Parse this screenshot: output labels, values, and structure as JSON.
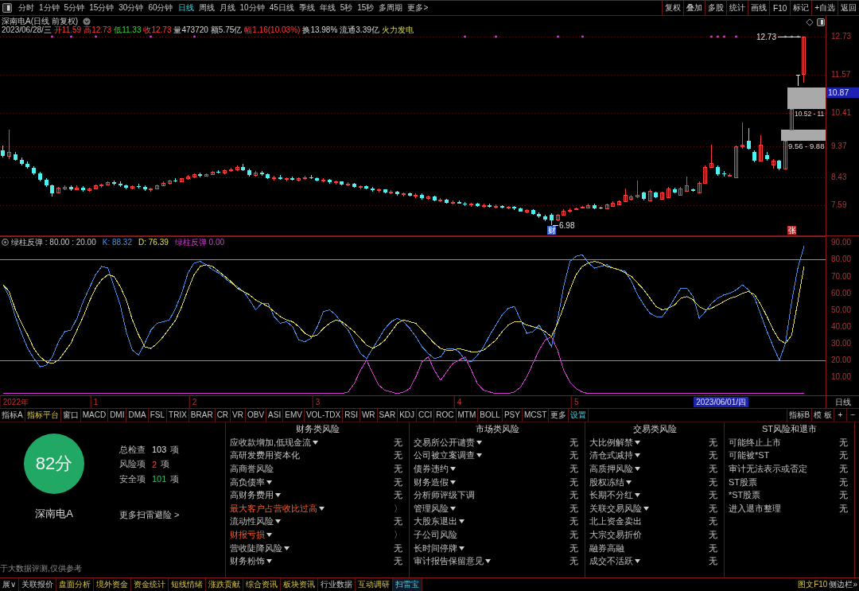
{
  "toolbar": {
    "periods": [
      {
        "label": "分时",
        "selected": false
      },
      {
        "label": "1分钟",
        "selected": false
      },
      {
        "label": "5分钟",
        "selected": false
      },
      {
        "label": "15分钟",
        "selected": false
      },
      {
        "label": "30分钟",
        "selected": false
      },
      {
        "label": "60分钟",
        "selected": false
      },
      {
        "label": "日线",
        "selected": true
      },
      {
        "label": "周线",
        "selected": false
      },
      {
        "label": "月线",
        "selected": false
      },
      {
        "label": "10分钟",
        "selected": false
      },
      {
        "label": "45日线",
        "selected": false
      },
      {
        "label": "季线",
        "selected": false
      },
      {
        "label": "年线",
        "selected": false
      },
      {
        "label": "5秒",
        "selected": false
      },
      {
        "label": "15秒",
        "selected": false
      },
      {
        "label": "多周期",
        "selected": false
      },
      {
        "label": "更多>",
        "selected": false
      }
    ],
    "actions": [
      "复权",
      "叠加",
      "多股",
      "统计",
      "画线",
      "F10",
      "标记",
      "+自选",
      "返回"
    ]
  },
  "quote": {
    "title": "深南电A(日线 前复权)",
    "date": "2023/06/28/三",
    "fields": [
      {
        "text": "开11.59",
        "kind": "up"
      },
      {
        "text": "高12.73",
        "kind": "up"
      },
      {
        "text": "低11.33",
        "kind": "down"
      },
      {
        "text": "收12.73",
        "kind": "up"
      },
      {
        "text": "量473720",
        "kind": "plain"
      },
      {
        "text": "额5.75亿",
        "kind": "plain"
      },
      {
        "text": "幅1.16(10.03%)",
        "kind": "up"
      },
      {
        "text": "换13.98%",
        "kind": "plain"
      },
      {
        "text": "流通3.39亿",
        "kind": "plain"
      },
      {
        "text": "火力发电",
        "kind": "sector"
      }
    ]
  },
  "main_chart": {
    "chart_data": [
      {
        "type": "candlestick",
        "ylim": [
          6.66,
          13.39
        ],
        "yticks": [
          12.73,
          11.57,
          10.41,
          9.37,
          8.43,
          7.59
        ],
        "tick_labels": "y",
        "grid": true,
        "ohlc": [
          [
            9.25,
            9.4,
            9.05,
            9.1
          ],
          [
            9.1,
            9.9,
            9.0,
            9.2
          ],
          [
            9.15,
            9.22,
            8.95,
            8.98
          ],
          [
            8.98,
            9.05,
            8.8,
            8.85
          ],
          [
            8.85,
            8.92,
            8.7,
            8.74
          ],
          [
            8.72,
            8.78,
            8.5,
            8.55
          ],
          [
            8.55,
            8.6,
            8.3,
            8.35
          ],
          [
            8.35,
            8.42,
            8.15,
            8.2
          ],
          [
            8.18,
            8.22,
            7.85,
            7.95
          ],
          [
            7.98,
            8.15,
            7.95,
            8.12
          ],
          [
            8.1,
            8.2,
            8.05,
            8.15
          ],
          [
            8.15,
            8.2,
            8.02,
            8.08
          ],
          [
            8.08,
            8.18,
            8.05,
            8.12
          ],
          [
            8.12,
            8.16,
            8.0,
            8.04
          ],
          [
            8.04,
            8.12,
            8.0,
            8.1
          ],
          [
            8.1,
            8.22,
            8.08,
            8.18
          ],
          [
            8.18,
            8.25,
            8.12,
            8.22
          ],
          [
            8.22,
            8.32,
            8.18,
            8.28
          ],
          [
            8.28,
            8.34,
            8.2,
            8.24
          ],
          [
            8.24,
            8.3,
            8.15,
            8.18
          ],
          [
            8.18,
            8.22,
            8.08,
            8.12
          ],
          [
            8.12,
            8.2,
            8.06,
            8.16
          ],
          [
            8.16,
            8.24,
            8.1,
            8.14
          ],
          [
            8.14,
            8.18,
            8.02,
            8.06
          ],
          [
            8.06,
            8.12,
            8.0,
            8.1
          ],
          [
            8.1,
            8.22,
            8.08,
            8.2
          ],
          [
            8.2,
            8.3,
            8.16,
            8.26
          ],
          [
            8.26,
            8.36,
            8.22,
            8.33
          ],
          [
            8.33,
            8.4,
            8.28,
            8.3
          ],
          [
            8.3,
            8.42,
            8.28,
            8.4
          ],
          [
            8.4,
            8.5,
            8.36,
            8.46
          ],
          [
            8.46,
            8.56,
            8.42,
            8.52
          ],
          [
            8.52,
            8.58,
            8.44,
            8.48
          ],
          [
            8.48,
            8.56,
            8.45,
            8.54
          ],
          [
            8.54,
            8.62,
            8.5,
            8.6
          ],
          [
            8.6,
            8.66,
            8.55,
            8.58
          ],
          [
            8.58,
            8.68,
            8.54,
            8.65
          ],
          [
            8.65,
            8.72,
            8.6,
            8.68
          ],
          [
            8.68,
            8.8,
            8.64,
            8.76
          ],
          [
            8.76,
            8.85,
            8.62,
            8.66
          ],
          [
            8.66,
            8.7,
            8.45,
            8.5
          ],
          [
            8.5,
            8.62,
            8.46,
            8.58
          ],
          [
            8.58,
            8.64,
            8.48,
            8.52
          ],
          [
            8.52,
            8.56,
            8.38,
            8.42
          ],
          [
            8.42,
            8.48,
            8.34,
            8.44
          ],
          [
            8.44,
            8.5,
            8.36,
            8.38
          ],
          [
            8.38,
            8.44,
            8.3,
            8.4
          ],
          [
            8.4,
            8.46,
            8.34,
            8.36
          ],
          [
            8.36,
            8.44,
            8.32,
            8.42
          ],
          [
            8.42,
            8.48,
            8.36,
            8.44
          ],
          [
            8.44,
            8.5,
            8.38,
            8.4
          ],
          [
            8.4,
            8.44,
            8.3,
            8.34
          ],
          [
            8.34,
            8.4,
            8.28,
            8.36
          ],
          [
            8.36,
            8.38,
            8.24,
            8.28
          ],
          [
            8.28,
            8.34,
            8.22,
            8.3
          ],
          [
            8.3,
            8.32,
            8.18,
            8.22
          ],
          [
            8.22,
            8.28,
            8.16,
            8.24
          ],
          [
            8.24,
            8.26,
            8.12,
            8.15
          ],
          [
            8.15,
            8.2,
            8.08,
            8.17
          ],
          [
            8.17,
            8.2,
            8.06,
            8.1
          ],
          [
            8.1,
            8.14,
            8.0,
            8.04
          ],
          [
            8.04,
            8.1,
            7.96,
            8.06
          ],
          [
            8.06,
            8.08,
            7.94,
            7.98
          ],
          [
            7.98,
            8.04,
            7.92,
            8.0
          ],
          [
            8.0,
            8.02,
            7.88,
            7.92
          ],
          [
            7.92,
            7.98,
            7.86,
            7.95
          ],
          [
            7.95,
            7.98,
            7.84,
            7.88
          ],
          [
            7.88,
            7.94,
            7.8,
            7.9
          ],
          [
            7.9,
            7.94,
            7.76,
            7.8
          ],
          [
            7.8,
            7.88,
            7.76,
            7.84
          ],
          [
            7.84,
            7.88,
            7.7,
            7.74
          ],
          [
            7.74,
            7.8,
            7.68,
            7.76
          ],
          [
            7.76,
            7.78,
            7.62,
            7.66
          ],
          [
            7.66,
            7.72,
            7.6,
            7.68
          ],
          [
            7.68,
            7.74,
            7.62,
            7.64
          ],
          [
            7.64,
            7.68,
            7.56,
            7.6
          ],
          [
            7.6,
            7.66,
            7.54,
            7.62
          ],
          [
            7.62,
            7.66,
            7.54,
            7.56
          ],
          [
            7.56,
            7.62,
            7.5,
            7.58
          ],
          [
            7.58,
            7.62,
            7.5,
            7.54
          ],
          [
            7.54,
            7.6,
            7.48,
            7.56
          ],
          [
            7.56,
            7.58,
            7.48,
            7.5
          ],
          [
            7.5,
            7.56,
            7.46,
            7.54
          ],
          [
            7.54,
            7.56,
            7.44,
            7.48
          ],
          [
            7.48,
            7.52,
            7.38,
            7.4
          ],
          [
            7.4,
            7.46,
            7.34,
            7.44
          ],
          [
            7.44,
            7.46,
            7.3,
            7.32
          ],
          [
            7.32,
            7.36,
            7.2,
            7.24
          ],
          [
            7.24,
            7.28,
            7.1,
            7.14
          ],
          [
            7.3,
            7.34,
            6.98,
            7.13
          ],
          [
            7.14,
            7.32,
            7.1,
            7.3
          ],
          [
            7.3,
            7.45,
            7.26,
            7.42
          ],
          [
            7.42,
            7.48,
            7.36,
            7.44
          ],
          [
            7.48,
            7.52,
            7.44,
            7.49
          ],
          [
            7.52,
            7.57,
            7.48,
            7.54
          ],
          [
            7.5,
            7.62,
            7.48,
            7.59
          ],
          [
            7.59,
            7.63,
            7.47,
            7.49
          ],
          [
            7.51,
            7.54,
            7.45,
            7.48
          ],
          [
            7.49,
            7.64,
            7.47,
            7.61
          ],
          [
            7.56,
            7.7,
            7.54,
            7.66
          ],
          [
            7.61,
            7.74,
            7.59,
            7.71
          ],
          [
            7.71,
            8.1,
            7.68,
            7.91
          ],
          [
            7.78,
            7.9,
            7.74,
            7.86
          ],
          [
            7.84,
            8.34,
            7.8,
            7.9
          ],
          [
            7.96,
            8.0,
            7.74,
            7.78
          ],
          [
            7.74,
            8.06,
            7.72,
            8.03
          ],
          [
            7.96,
            8.0,
            7.8,
            7.83
          ],
          [
            7.78,
            7.99,
            7.76,
            7.96
          ],
          [
            7.83,
            8.14,
            7.8,
            8.1
          ],
          [
            8.08,
            8.12,
            7.94,
            7.96
          ],
          [
            7.91,
            8.14,
            7.88,
            8.1
          ],
          [
            8.03,
            8.45,
            8.0,
            8.2
          ],
          [
            8.06,
            8.1,
            8.0,
            8.03
          ],
          [
            7.96,
            8.3,
            7.94,
            8.27
          ],
          [
            8.27,
            8.8,
            8.24,
            8.76
          ],
          [
            8.76,
            9.42,
            8.72,
            8.88
          ],
          [
            8.76,
            8.8,
            8.48,
            8.52
          ],
          [
            8.56,
            8.62,
            8.45,
            8.53
          ],
          [
            8.48,
            8.56,
            8.45,
            8.51
          ],
          [
            8.44,
            9.4,
            8.42,
            9.37
          ],
          [
            9.37,
            10.1,
            9.3,
            9.44
          ],
          [
            9.54,
            9.93,
            9.28,
            9.32
          ],
          [
            9.2,
            9.25,
            8.9,
            8.95
          ],
          [
            8.95,
            9.73,
            8.92,
            9.42
          ],
          [
            9.12,
            9.2,
            8.95,
            9.0
          ],
          [
            8.83,
            9.0,
            8.7,
            8.95
          ],
          [
            8.95,
            8.98,
            8.65,
            8.69
          ],
          [
            8.7,
            9.56,
            8.7,
            9.56
          ],
          [
            9.88,
            10.52,
            9.88,
            10.52
          ],
          [
            11.57,
            11.57,
            11.23,
            11.57
          ],
          [
            11.59,
            12.73,
            11.33,
            12.73
          ],
          null,
          null,
          null
        ],
        "bands": [
          {
            "axis": "y",
            "from": 10.52,
            "to": 11.18,
            "label": "10.52 - 11",
            "color": "#a9a9a9"
          },
          {
            "axis": "y",
            "from": 9.56,
            "to": 9.88,
            "label": "9.56 - 9.88",
            "color": "#a9a9a9"
          }
        ],
        "annotations": [
          "12.73",
          "6.98",
          "财",
          "张",
          "10.87"
        ]
      }
    ]
  },
  "sub_chart": {
    "title": "绿柱反弹 : 80.00 : 20.00",
    "readings": [
      "K: 88.32",
      "D: 76.39",
      "绿柱反弹 0.00"
    ],
    "chart_data": [
      {
        "type": "line",
        "ylim": [
          -1,
          94
        ],
        "yticks": [
          {
            "value": 90,
            "label": "90.00"
          },
          {
            "value": 80,
            "label": "80.00"
          },
          {
            "value": 70,
            "label": "70.00"
          },
          {
            "value": 60,
            "label": "60.00"
          },
          {
            "value": 50,
            "label": "50.00"
          },
          {
            "value": 40,
            "label": "40.00"
          },
          {
            "value": 30,
            "label": "30.00"
          },
          {
            "value": 20,
            "label": "20.00"
          },
          {
            "value": 10,
            "label": "10.00"
          }
        ],
        "ref_lines": [
          {
            "axis": "y",
            "value": 80,
            "color": "#8e8e8e"
          },
          {
            "axis": "y",
            "value": 20,
            "color": "#8e8e8e"
          }
        ],
        "categories": [
          null,
          null,
          "2022年",
          null,
          null,
          null,
          null,
          null,
          null,
          null,
          null,
          null,
          null,
          null,
          null,
          "1",
          null,
          null,
          null,
          null,
          null,
          null,
          null,
          null,
          null,
          null,
          null,
          null,
          null,
          null,
          null,
          "2",
          null,
          null,
          null,
          null,
          null,
          null,
          null,
          null,
          null,
          null,
          null,
          null,
          null,
          null,
          null,
          null,
          null,
          null,
          null,
          "3",
          null,
          null,
          null,
          null,
          null,
          null,
          null,
          null,
          null,
          null,
          null,
          null,
          null,
          null,
          null,
          null,
          null,
          null,
          null,
          null,
          null,
          null,
          "4",
          null,
          null,
          null,
          null,
          null,
          null,
          null,
          null,
          null,
          null,
          null,
          null,
          null,
          null,
          null,
          null,
          null,
          null,
          "5",
          null,
          null,
          null,
          null,
          null,
          null,
          null,
          null,
          null,
          null,
          null,
          null,
          null,
          null,
          null,
          null,
          null,
          null,
          null,
          null,
          null,
          null,
          null,
          null,
          null,
          null,
          null,
          null,
          null,
          null,
          null,
          null,
          null,
          null,
          null,
          null,
          null,
          null,
          null,
          null
        ],
        "annotations": [
          "2023/06/01/四"
        ],
        "series": [
          {
            "color": "#4a90e8",
            "values": [
              65,
              58,
              46,
              36,
              27,
              21,
              16,
              17,
              22,
              31,
              37,
              38,
              45,
              55,
              63,
              71,
              76,
              75,
              64,
              53,
              37,
              26,
              23,
              30,
              38,
              42,
              43,
              44,
              51,
              60,
              72,
              78,
              79,
              77,
              74,
              72,
              69,
              66,
              64,
              61,
              56,
              50,
              54,
              54,
              46,
              42,
              43,
              40,
              32,
              31,
              33,
              40,
              49,
              50,
              47,
              42,
              38,
              31,
              24,
              21,
              27,
              33,
              39,
              43,
              45,
              43,
              39,
              34,
              28,
              24,
              21,
              22,
              27,
              27,
              25,
              20,
              19,
              23,
              28,
              35,
              41,
              47,
              51,
              52,
              44,
              36,
              37,
              41,
              35,
              28,
              44,
              64,
              79,
              82,
              83,
              78,
              75,
              76,
              77,
              75,
              74,
              73,
              67,
              59,
              53,
              48,
              46,
              46,
              51,
              57,
              63,
              63,
              58,
              45,
              49,
              54,
              57,
              59,
              60,
              62,
              65,
              62,
              57,
              47,
              37,
              28,
              20,
              30,
              55,
              75,
              88,
              null,
              null,
              null
            ]
          },
          {
            "color": "#e6e04a",
            "values": [
              65,
              61,
              50,
              42,
              35,
              27,
              22,
              19,
              18,
              20,
              25,
              30,
              38,
              46,
              55,
              63,
              68,
              71,
              70,
              64,
              56,
              44,
              35,
              28,
              27,
              30,
              34,
              39,
              44,
              52,
              62,
              71,
              76,
              77,
              76,
              73,
              70,
              67,
              63,
              61,
              59,
              56,
              54,
              52,
              49,
              46,
              44,
              43,
              40,
              36,
              34,
              35,
              39,
              42,
              44,
              43,
              40,
              37,
              33,
              29,
              27,
              29,
              32,
              37,
              42,
              44,
              43,
              42,
              38,
              34,
              30,
              27,
              26,
              26,
              27,
              26,
              25,
              25,
              26,
              29,
              32,
              37,
              41,
              43,
              43,
              41,
              40,
              39,
              37,
              34,
              42,
              52,
              62,
              71,
              76,
              78,
              79,
              78,
              76,
              75,
              74,
              72,
              70,
              66,
              62,
              57,
              52,
              50,
              51,
              53,
              57,
              58,
              56,
              52,
              50,
              51,
              53,
              55,
              57,
              58,
              60,
              61,
              59,
              53,
              46,
              38,
              32,
              30,
              35,
              55,
              76,
              null,
              null,
              null
            ]
          },
          {
            "color": "#d43cd4",
            "values": [
              0,
              0,
              0,
              0,
              0,
              0,
              0,
              0,
              0,
              0,
              0,
              0,
              0,
              0,
              0,
              0,
              0,
              0,
              0,
              0,
              0,
              0,
              0,
              0,
              0,
              0,
              0,
              0,
              0,
              0,
              0,
              0,
              0,
              0,
              0,
              0,
              0,
              0,
              0,
              0,
              0,
              0,
              0,
              0,
              0,
              0,
              0,
              0,
              0,
              0,
              0,
              0,
              0,
              0,
              0,
              0,
              1,
              6,
              14,
              20,
              12,
              5,
              2,
              1,
              0,
              1,
              3,
              10,
              19,
              22,
              14,
              8,
              13,
              18,
              20,
              22,
              14,
              6,
              2,
              1,
              0,
              0,
              0,
              1,
              4,
              10,
              18,
              26,
              32,
              34,
              26,
              14,
              7,
              3,
              1,
              0,
              0,
              0,
              0,
              0,
              0,
              0,
              0,
              0,
              0,
              0,
              0,
              0,
              0,
              0,
              0,
              0,
              0,
              0,
              0,
              0,
              0,
              0,
              0,
              0,
              0,
              0,
              0,
              0,
              0,
              0,
              0,
              0,
              0,
              0,
              0,
              null,
              null,
              null
            ]
          }
        ]
      }
    ]
  },
  "time_axis": {
    "period": "日线"
  },
  "indicator_tabs": {
    "left": [
      {
        "label": "指标A",
        "kind": "plain"
      },
      {
        "label": "指标平台",
        "kind": "accent"
      },
      {
        "label": "窗口",
        "kind": "plain"
      },
      {
        "label": "MACD",
        "kind": "plain"
      },
      {
        "label": "DMI",
        "kind": "plain"
      },
      {
        "label": "DMA",
        "kind": "plain"
      },
      {
        "label": "FSL",
        "kind": "plain"
      },
      {
        "label": "TRIX",
        "kind": "plain"
      },
      {
        "label": "BRAR",
        "kind": "plain"
      },
      {
        "label": "CR",
        "kind": "plain"
      },
      {
        "label": "VR",
        "kind": "plain"
      },
      {
        "label": "OBV",
        "kind": "plain"
      },
      {
        "label": "ASI",
        "kind": "plain"
      },
      {
        "label": "EMV",
        "kind": "plain"
      },
      {
        "label": "VOL-TDX",
        "kind": "plain"
      },
      {
        "label": "RSI",
        "kind": "plain"
      },
      {
        "label": "WR",
        "kind": "plain"
      },
      {
        "label": "SAR",
        "kind": "plain"
      },
      {
        "label": "KDJ",
        "kind": "plain"
      },
      {
        "label": "CCI",
        "kind": "plain"
      },
      {
        "label": "ROC",
        "kind": "plain"
      },
      {
        "label": "MTM",
        "kind": "plain"
      },
      {
        "label": "BOLL",
        "kind": "plain"
      },
      {
        "label": "PSY",
        "kind": "plain"
      },
      {
        "label": "MCST",
        "kind": "plain"
      },
      {
        "label": "更多",
        "kind": "plain"
      },
      {
        "label": "设置",
        "kind": "setting"
      }
    ],
    "right": [
      {
        "label": "指标B",
        "kind": "plain"
      },
      {
        "label": "模 板",
        "kind": "plain"
      },
      {
        "label": "+",
        "kind": "plain"
      },
      {
        "label": "−",
        "kind": "plain"
      }
    ]
  },
  "scan": {
    "score": "82分",
    "stock": "深南电A",
    "stats": [
      {
        "label": "总检查",
        "value": "103",
        "unit": "项",
        "kind": "total"
      },
      {
        "label": "风险项",
        "value": "2",
        "unit": "项",
        "kind": "risk"
      },
      {
        "label": "安全项",
        "value": "101",
        "unit": "项",
        "kind": "safe"
      }
    ],
    "more": "更多扫雷避险 >",
    "footnote": "于大数据评测,仅供参考",
    "columns": [
      {
        "title": "财务类风险",
        "items": [
          {
            "label": "应收款增加,低现金流",
            "dropdown": true,
            "risk": false,
            "result": "无"
          },
          {
            "label": "高研发费用资本化",
            "dropdown": false,
            "risk": false,
            "result": "无"
          },
          {
            "label": "高商誉风险",
            "dropdown": false,
            "risk": false,
            "result": "无"
          },
          {
            "label": "高负债率",
            "dropdown": true,
            "risk": false,
            "result": "无"
          },
          {
            "label": "高财务费用",
            "dropdown": true,
            "risk": false,
            "result": "无"
          },
          {
            "label": "最大客户占营收比过高",
            "dropdown": true,
            "risk": true,
            "result": "〉"
          },
          {
            "label": "流动性风险",
            "dropdown": true,
            "risk": false,
            "result": "无"
          },
          {
            "label": "财报亏损",
            "dropdown": true,
            "risk": true,
            "result": "〉"
          },
          {
            "label": "营收陡降风险",
            "dropdown": true,
            "risk": false,
            "result": "无"
          },
          {
            "label": "财务粉饰",
            "dropdown": true,
            "risk": false,
            "result": "无"
          }
        ]
      },
      {
        "title": "市场类风险",
        "items": [
          {
            "label": "交易所公开谴责",
            "dropdown": true,
            "risk": false,
            "result": "无"
          },
          {
            "label": "公司被立案调查",
            "dropdown": true,
            "risk": false,
            "result": "无"
          },
          {
            "label": "债券违约",
            "dropdown": true,
            "risk": false,
            "result": "无"
          },
          {
            "label": "财务造假",
            "dropdown": true,
            "risk": false,
            "result": "无"
          },
          {
            "label": "分析师评级下调",
            "dropdown": false,
            "risk": false,
            "result": "无"
          },
          {
            "label": "管理风险",
            "dropdown": true,
            "risk": false,
            "result": "无"
          },
          {
            "label": "大股东退出",
            "dropdown": true,
            "risk": false,
            "result": "无"
          },
          {
            "label": "子公司风险",
            "dropdown": false,
            "risk": false,
            "result": "无"
          },
          {
            "label": "长时间停牌",
            "dropdown": true,
            "risk": false,
            "result": "无"
          },
          {
            "label": "审计报告保留意见",
            "dropdown": true,
            "risk": false,
            "result": "无"
          }
        ]
      },
      {
        "title": "交易类风险",
        "items": [
          {
            "label": "大比例解禁",
            "dropdown": true,
            "risk": false,
            "result": "无"
          },
          {
            "label": "清仓式减持",
            "dropdown": true,
            "risk": false,
            "result": "无"
          },
          {
            "label": "高质押风险",
            "dropdown": true,
            "risk": false,
            "result": "无"
          },
          {
            "label": "股权冻结",
            "dropdown": true,
            "risk": false,
            "result": "无"
          },
          {
            "label": "长期不分红",
            "dropdown": true,
            "risk": false,
            "result": "无"
          },
          {
            "label": "关联交易风险",
            "dropdown": true,
            "risk": false,
            "result": "无"
          },
          {
            "label": "北上资金卖出",
            "dropdown": false,
            "risk": false,
            "result": "无"
          },
          {
            "label": "大宗交易折价",
            "dropdown": false,
            "risk": false,
            "result": "无"
          },
          {
            "label": "融券高融",
            "dropdown": false,
            "risk": false,
            "result": "无"
          },
          {
            "label": "成交不活跃",
            "dropdown": true,
            "risk": false,
            "result": "无"
          }
        ]
      },
      {
        "title": "ST风险和退市",
        "items": [
          {
            "label": "可能终止上市",
            "dropdown": false,
            "risk": false,
            "result": "无"
          },
          {
            "label": "可能被*ST",
            "dropdown": false,
            "risk": false,
            "result": "无"
          },
          {
            "label": "审计无法表示或否定",
            "dropdown": false,
            "risk": false,
            "result": "无"
          },
          {
            "label": "ST股票",
            "dropdown": false,
            "risk": false,
            "result": "无"
          },
          {
            "label": "*ST股票",
            "dropdown": false,
            "risk": false,
            "result": "无"
          },
          {
            "label": "进入退市整理",
            "dropdown": false,
            "risk": false,
            "result": "无"
          }
        ]
      }
    ]
  },
  "bottom_tabs": [
    {
      "label": "展∨",
      "kind": "plain",
      "selected": false
    },
    {
      "label": "关联报价",
      "kind": "plain",
      "selected": false
    },
    {
      "label": "盘面分析",
      "kind": "accent",
      "selected": false
    },
    {
      "label": "境外资金",
      "kind": "accent",
      "selected": false
    },
    {
      "label": "资金统计",
      "kind": "accent",
      "selected": false
    },
    {
      "label": "短线情绪",
      "kind": "accent",
      "selected": false
    },
    {
      "label": "涨跌贡献",
      "kind": "accent",
      "selected": false
    },
    {
      "label": "综合资讯",
      "kind": "accent",
      "selected": false
    },
    {
      "label": "板块资讯",
      "kind": "accent",
      "selected": false
    },
    {
      "label": "行业数据",
      "kind": "plain",
      "selected": false
    },
    {
      "label": "互动调研",
      "kind": "accent",
      "selected": false
    },
    {
      "label": "扫雷宝",
      "kind": "plain",
      "selected": true
    }
  ],
  "side_links": [
    {
      "label": "图文F10",
      "kind": "accent"
    },
    {
      "label": "侧边栏»",
      "kind": "plain"
    }
  ]
}
